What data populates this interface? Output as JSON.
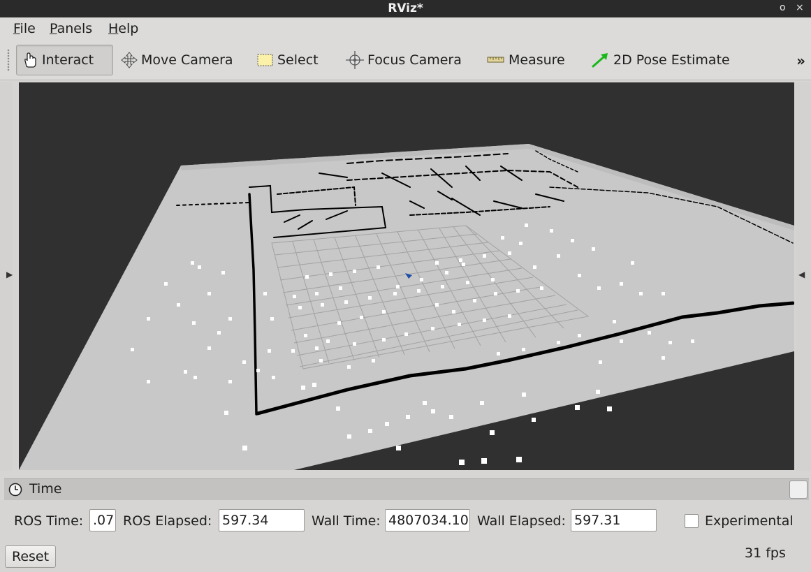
{
  "window": {
    "title": "RViz*",
    "controls": [
      "o",
      "×"
    ]
  },
  "menu": [
    {
      "mnemonic": "F",
      "rest": "ile"
    },
    {
      "mnemonic": "P",
      "rest": "anels"
    },
    {
      "mnemonic": "H",
      "rest": "elp"
    }
  ],
  "toolbar": {
    "tools": [
      {
        "label": "Interact",
        "icon": "hand-icon",
        "active": true
      },
      {
        "label": "Move Camera",
        "icon": "move-arrows-icon"
      },
      {
        "label": "Select",
        "icon": "select-rectangle-icon"
      },
      {
        "label": "Focus Camera",
        "icon": "crosshair-icon"
      },
      {
        "label": "Measure",
        "icon": "ruler-icon"
      },
      {
        "label": "2D Pose Estimate",
        "icon": "green-arrow-icon"
      }
    ],
    "overflow": "»"
  },
  "time_panel": {
    "title": "Time",
    "ros_time_label": "ROS Time:",
    "ros_time_value": ".07",
    "ros_elapsed_label": "ROS Elapsed:",
    "ros_elapsed_value": "597.34",
    "wall_time_label": "Wall Time:",
    "wall_time_value": "4807034.10",
    "wall_elapsed_label": "Wall Elapsed:",
    "wall_elapsed_value": "597.31",
    "experimental_label": "Experimental",
    "experimental_checked": false,
    "reset_label": "Reset",
    "fps": "31 fps"
  },
  "colors": {
    "viewport_background": "#303030",
    "map_free": "#c8c8c8",
    "map_occupied": "#000000",
    "grid": "#a0a0a0",
    "point_cloud": "#ffffff",
    "robot": "#1f4fa8"
  }
}
